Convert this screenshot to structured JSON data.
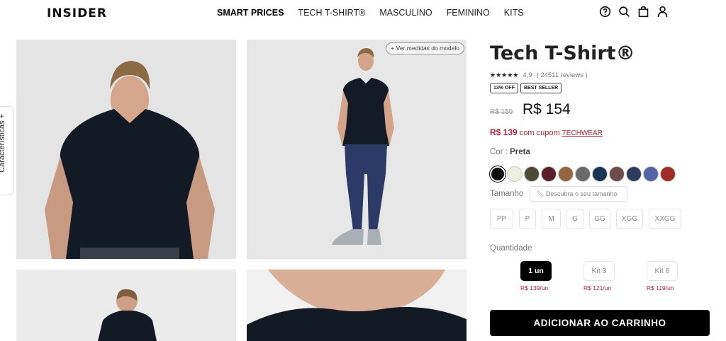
{
  "header": {
    "logo": "INSIDER",
    "nav": [
      "SMART PRICES",
      "TECH T-SHIRT®",
      "MASCULINO",
      "FEMININO",
      "KITS"
    ]
  },
  "side_tab": {
    "label": "Características  +"
  },
  "gallery": {
    "measure_button": "+ Ver medidas do modelo"
  },
  "product": {
    "title": "Tech T-Shirt®",
    "stars": "★★★★★",
    "rating": "4,9",
    "reviews": "( 24511 reviews )",
    "badges": [
      "13% OFF",
      "BEST SELLER"
    ],
    "old_price": "R$ 159",
    "price": "R$ 154",
    "coupon_price": "R$ 139",
    "coupon_text": "com cupom",
    "coupon_code": "TECHWEAR",
    "color_label": "Cor :",
    "color_value": "Preta",
    "colors": [
      "#0b0b0b",
      "#eeeee0",
      "#4b4b37",
      "#5b1f2b",
      "#94653e",
      "#6b6b6b",
      "#1c3553",
      "#6d4d4b",
      "#2e3b5f",
      "#5264a6",
      "#9e2e25"
    ],
    "size_label": "Tamanho",
    "size_discover": "Descubra o seu tamanho",
    "sizes": [
      "PP",
      "P",
      "M",
      "G",
      "GG",
      "XGG",
      "XXGG"
    ],
    "qty_label": "Quantidade",
    "kits": [
      {
        "label": "1 un",
        "price": "R$ 139/un"
      },
      {
        "label": "Kit 3",
        "price": "R$ 121/un"
      },
      {
        "label": "Kit 6",
        "price": "R$ 119/un"
      }
    ],
    "cart_button": "ADICIONAR AO CARRINHO"
  }
}
